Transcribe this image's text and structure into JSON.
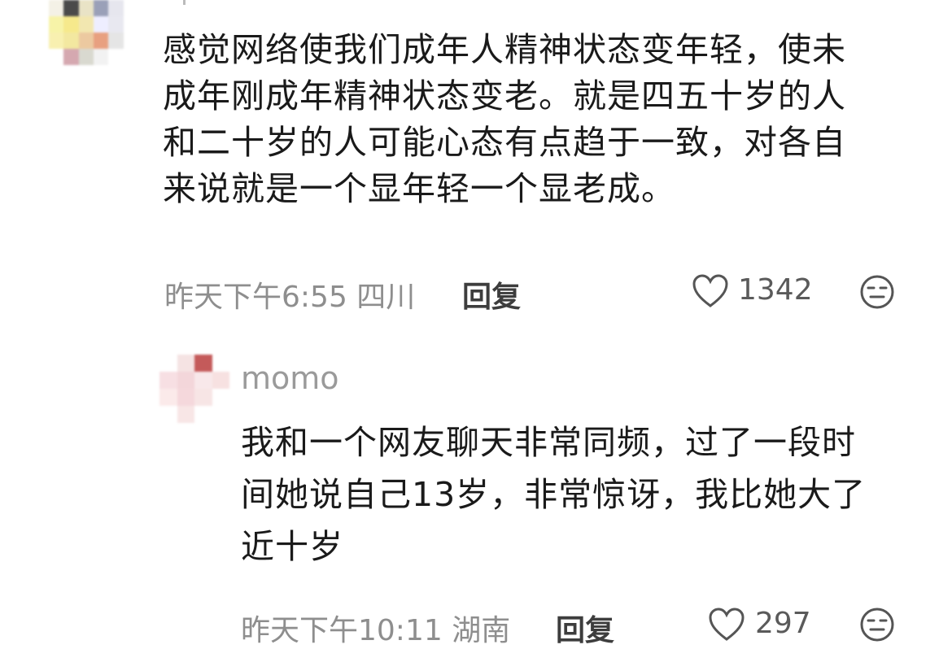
{
  "comment1": {
    "text_lines": [
      "感觉网络使我们成年人精神状态变年轻，使未",
      "成年刚成年精神状态变老。就是四五十岁的人",
      "和二十岁的人可能心态有点趋于一致，对各自",
      "来说就是一个显年轻一个显老成。"
    ],
    "timestamp": "昨天下午6:55",
    "location": "四川",
    "reply_label": "回复",
    "likes": "1342"
  },
  "reply1": {
    "username": "momo",
    "text_lines": [
      "我和一个网友聊天非常同频，过了一段时",
      "间她说自己13岁，非常惊讶，我比她大了",
      "近十岁"
    ],
    "timestamp": "昨天下午10:11",
    "location": "湖南",
    "reply_label": "回复",
    "likes": "297"
  },
  "icons": {
    "like": "heart-outline-icon",
    "emoji": "neutral-face-icon"
  },
  "colors": {
    "text": "#1a1a1a",
    "meta": "#8e8e8e",
    "username": "#9a9a9a"
  }
}
